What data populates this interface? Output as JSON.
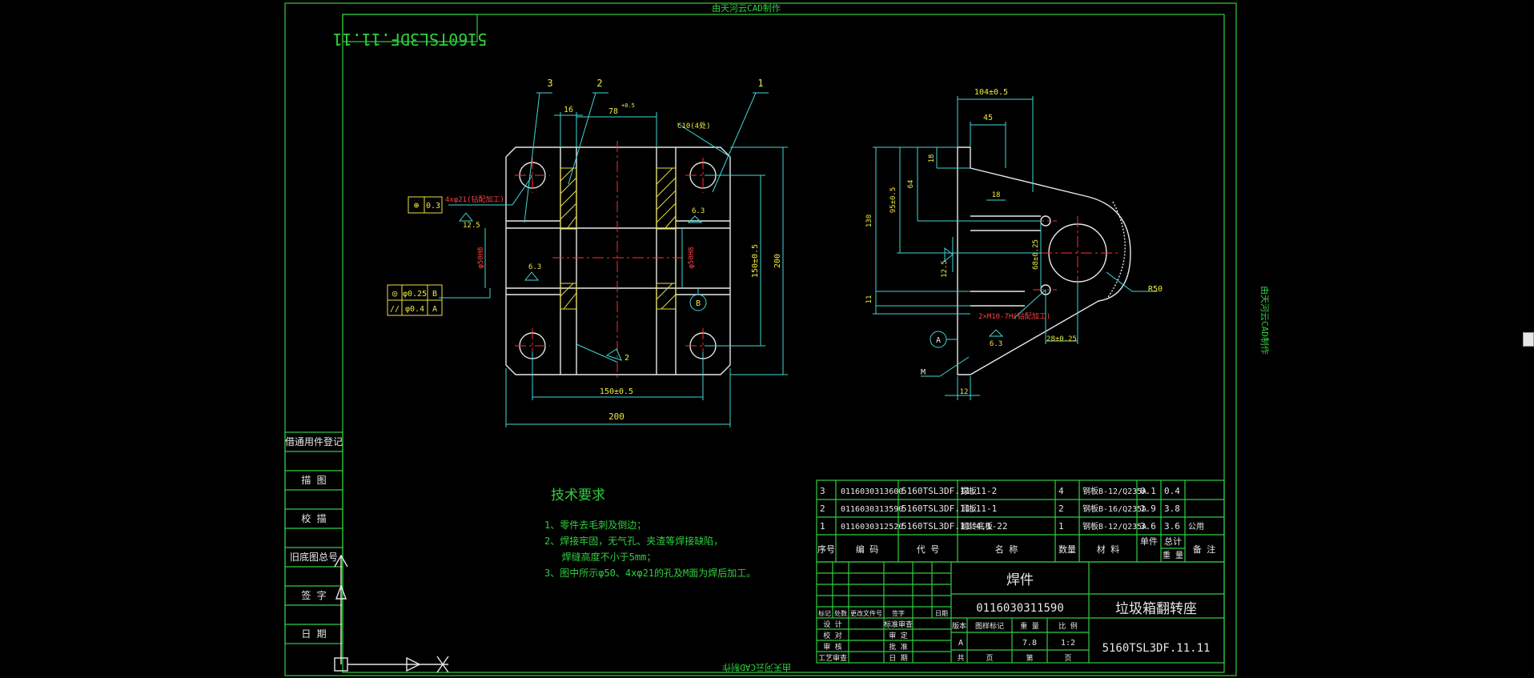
{
  "watermark": {
    "top": "由天河云CAD制作",
    "bottom": "由天河云CAD制作",
    "side": "由天河云CAD制作"
  },
  "corner_stamp": "5160TSL3DF.11.11",
  "left_table": [
    "借通用件登记",
    "描 图",
    "校 描",
    "旧底图总号",
    "签 字",
    "日 期"
  ],
  "tech_req": {
    "title": "技术要求",
    "lines": [
      "1、零件去毛刺及倒边；",
      "2、焊接牢固，无气孔、夹渣等焊接缺陷，",
      "   焊缝高度不小于5mm；",
      "3、图中所示φ50、4xφ21的孔及M面为焊后加工。"
    ]
  },
  "front_view": {
    "leaders": [
      "3",
      "2",
      "1"
    ],
    "dims": [
      "16",
      "78",
      "+0.5",
      "C10(4处)",
      "150±0.5",
      "200",
      "150±0.5",
      "200",
      "φ50H8",
      "φ50H8",
      "4xφ21(钻配加工)",
      "12.5",
      "6.3",
      "6.3",
      "2"
    ],
    "tol1": {
      "sym": "⊕",
      "val": "0.3"
    },
    "tol2": [
      {
        "sym": "◎",
        "val": "φ0.25",
        "ref": "B"
      },
      {
        "sym": "//",
        "val": "φ0.4",
        "ref": "A"
      }
    ],
    "datum_b": "B"
  },
  "side_view": {
    "dims": [
      "104±0.5",
      "45",
      "18",
      "64",
      "95±0.5",
      "130",
      "18",
      "11",
      "68±0.25",
      "12.5",
      "R50",
      "2×M10-7H(钻配加工)",
      "6.3",
      "28±0.25",
      "12",
      "M"
    ],
    "datum_a": "A"
  },
  "bom": {
    "rows": [
      [
        "3",
        "0116030313600",
        "5160TSL3DF.11.11-2",
        "撑板",
        "4",
        "钢板B-12/Q235A",
        "0.1",
        "0.4",
        ""
      ],
      [
        "2",
        "0116030313590",
        "5160TSL3DF.11.11-1",
        "耳板",
        "2",
        "钢板B-16/Q235A",
        "1.9",
        "3.8",
        ""
      ],
      [
        "1",
        "0116030312520",
        "5160TSL3DF.11.4.1-22",
        "翻转底板",
        "1",
        "钢板B-12/Q235A",
        "3.6",
        "3.6",
        "公用"
      ]
    ],
    "header": [
      "序号",
      "编 码",
      "代 号",
      "名 称",
      "数量",
      "材 料",
      "单件",
      "总计",
      "备 注"
    ],
    "weight_label": "重 量"
  },
  "title_block": {
    "type": "焊件",
    "code": "0116030311590",
    "name": "垃圾箱翻转座",
    "drawing_no": "5160TSL3DF.11.11",
    "row_labels": [
      "标记",
      "处数",
      "更改文件号",
      "签字",
      "日期"
    ],
    "roles": [
      "设 计",
      "校 对",
      "审 核",
      "工艺审查"
    ],
    "roles2": [
      "标准审查",
      "审 定",
      "批 准",
      "日 期"
    ],
    "stage_headers": [
      "版本",
      "图样标记",
      "重 量",
      "比 例"
    ],
    "stage_vals": [
      "A",
      "7.8",
      "1:2"
    ],
    "sheet": [
      "共",
      "页",
      "第",
      "页"
    ]
  }
}
